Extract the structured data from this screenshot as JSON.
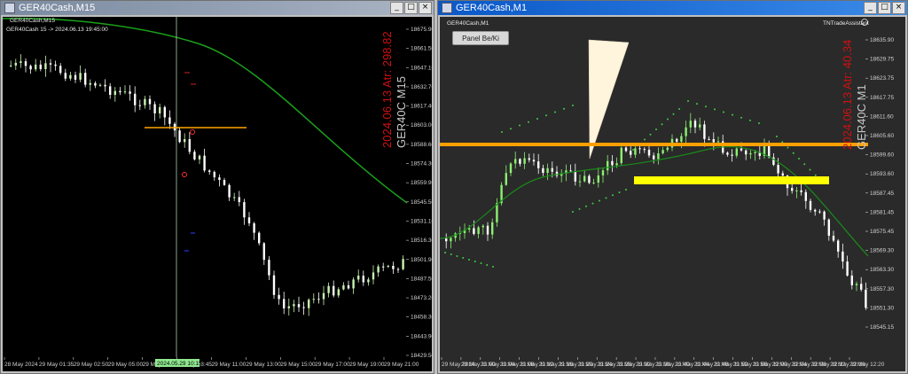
{
  "left_window": {
    "title": "GER40Cash,M15",
    "header_line1": "GER40Cash,M15",
    "header_line2": "GER40Cash 15 -> 2024.06.13 19:45:00",
    "overlay_symbol": "GER40C M15",
    "overlay_info": "2024.06.13 Atr: 298.82",
    "price_axis": [
      "18675.90",
      "18661.50",
      "18647.10",
      "18632.70",
      "18617.40",
      "18603.00",
      "18588.60",
      "18574.30",
      "18559.90",
      "18545.50",
      "18531.10",
      "18516.30",
      "18501.90",
      "18487.50",
      "18473.20",
      "18458.30",
      "18443.90",
      "18429.50"
    ],
    "time_axis": [
      "28 May 2024",
      "29 May 01:35",
      "29 May 02:50",
      "29 May 05:00",
      "29 May 07:00",
      "29 May 08:45",
      "29 May 11:00",
      "29 May 13:00",
      "29 May 15:00",
      "29 May 17:00",
      "29 May 19:00",
      "29 May 21:00"
    ],
    "cursor_time_label": "2024.05.29 10:15",
    "buttons": {
      "minimize": "_",
      "maximize": "□",
      "close": "×"
    },
    "colors": {
      "background": "#000000",
      "bull": "#c8f5b0",
      "bear": "#ffffff",
      "ma": "#1aa01a",
      "level": "#ffa500",
      "overlay_symbol": "#c8c8c8",
      "overlay_info": "#d01010"
    }
  },
  "right_window": {
    "title": "GER40Cash,M1",
    "header_line1": "GER40Cash,M1",
    "panel_button": "Panel Be/Ki",
    "assistant_label": "TNTradeAssistant",
    "overlay_symbol": "GER40C M1",
    "overlay_info": "2024.06.13 Atr: 40.34",
    "price_axis": [
      "18635.90",
      "18629.75",
      "18623.75",
      "18617.75",
      "18611.60",
      "18605.60",
      "18599.60",
      "18593.60",
      "18587.45",
      "18581.45",
      "18575.45",
      "18569.30",
      "18563.30",
      "18557.30",
      "18551.30",
      "18545.15"
    ],
    "time_axis": [
      "29 May 2024",
      "29 May 11:00",
      "29 May 11:04",
      "29 May 11:08",
      "29 May 11:12",
      "29 May 11:16",
      "29 May 11:20",
      "29 May 11:24",
      "29 May 11:28",
      "29 May 11:32",
      "29 May 11:36",
      "29 May 11:40",
      "29 May 11:44",
      "29 May 11:48",
      "29 May 11:52",
      "29 May 11:56",
      "29 May 12:00",
      "29 May 12:04",
      "29 May 12:08",
      "29 May 12:12",
      "29 May 12:16",
      "29 May 12:20"
    ],
    "buttons": {
      "minimize": "_",
      "maximize": "□",
      "close": "×"
    },
    "colors": {
      "background": "#2a2a2a",
      "bull": "#8cf070",
      "bear": "#ffffff",
      "ma": "#1a8a1a",
      "sar": "#40d040",
      "level": "#ffa000",
      "zone": "#ffff00",
      "wedge": "#fff4dc",
      "overlay_symbol": "#c8c8c8",
      "overlay_info": "#d01010"
    }
  }
}
